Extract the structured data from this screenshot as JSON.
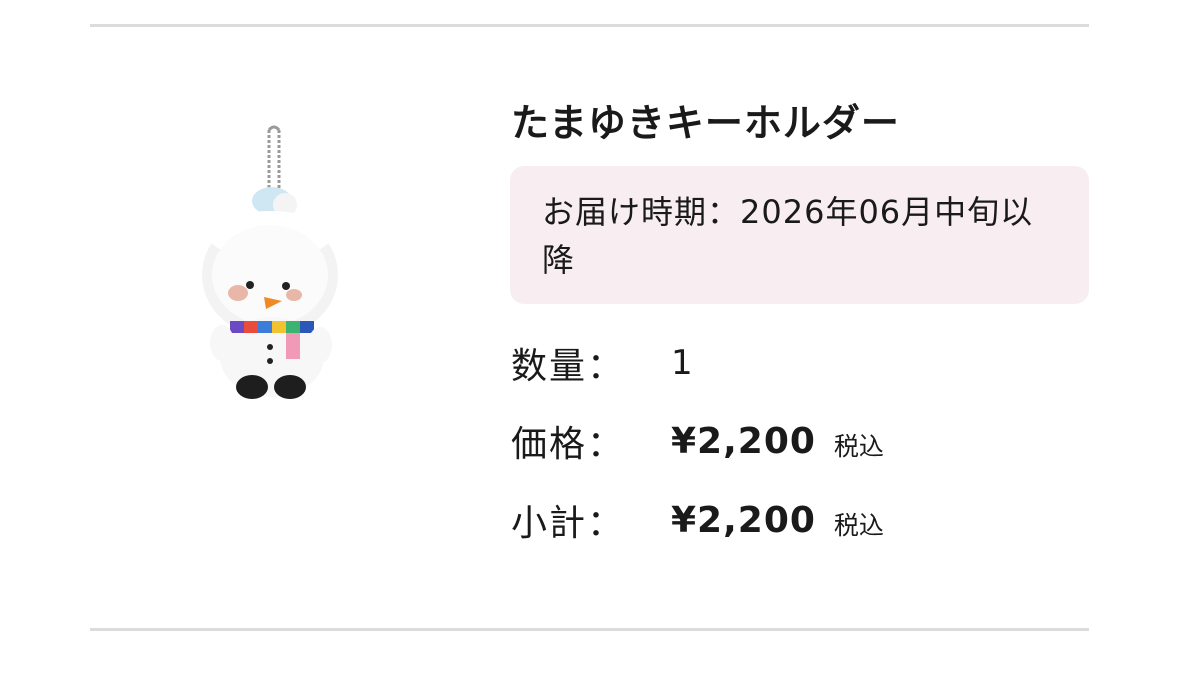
{
  "product": {
    "image_alt": "snowman plush keychain",
    "title": "たまゆきキーホルダー",
    "delivery": "お届け時期：2026年06月中旬以降",
    "quantity_label": "数量：",
    "quantity_value": "1",
    "price_label": "価格：",
    "price_value": "¥2,200",
    "price_tax": "税込",
    "subtotal_label": "小計：",
    "subtotal_value": "¥2,200",
    "subtotal_tax": "税込"
  },
  "colors": {
    "delivery_bg": "#f8eef2",
    "divider": "#dcdcdc"
  }
}
